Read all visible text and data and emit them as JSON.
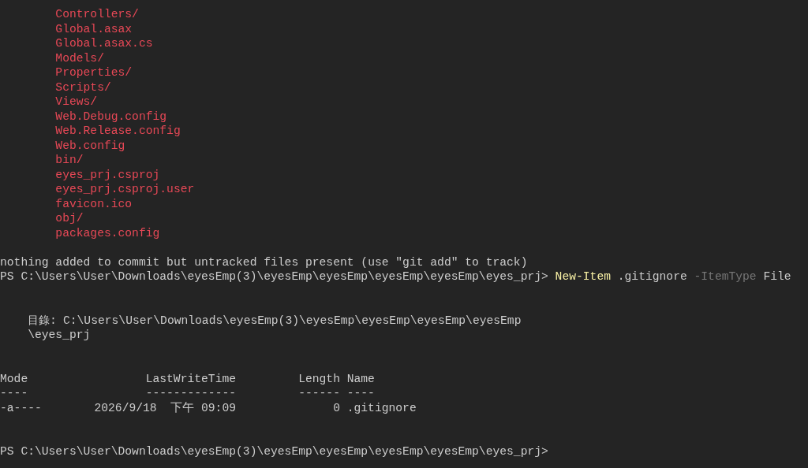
{
  "untracked_files": [
    "Controllers/",
    "Global.asax",
    "Global.asax.cs",
    "Models/",
    "Properties/",
    "Scripts/",
    "Views/",
    "Web.Debug.config",
    "Web.Release.config",
    "Web.config",
    "bin/",
    "eyes_prj.csproj",
    "eyes_prj.csproj.user",
    "favicon.ico",
    "obj/",
    "packages.config"
  ],
  "message": "nothing added to commit but untracked files present (use \"git add\" to track)",
  "command": {
    "prompt": "PS C:\\Users\\User\\Downloads\\eyesEmp(3)\\eyesEmp\\eyesEmp\\eyesEmp\\eyesEmp\\eyes_prj>",
    "tokens": [
      {
        "text": "New-Item",
        "kind": "cmdlet"
      },
      {
        "text": ".gitignore",
        "kind": "argument"
      },
      {
        "text": "-ItemType",
        "kind": "parameter"
      },
      {
        "text": "File",
        "kind": "argument"
      }
    ]
  },
  "directory": {
    "label": "目錄:",
    "path_lines": [
      "C:\\Users\\User\\Downloads\\eyesEmp(3)\\eyesEmp\\eyesEmp\\eyesEmp\\eyesEmp",
      "\\eyes_prj"
    ]
  },
  "table": {
    "columns": [
      "Mode",
      "LastWriteTime",
      "Length",
      "Name"
    ],
    "rules": [
      "----",
      "-------------",
      "------",
      "----"
    ],
    "rows": [
      {
        "mode": "-a----",
        "last_write_time": "2026/9/18  下午 09:09",
        "length": "0",
        "name": ".gitignore"
      }
    ]
  },
  "prompt": "PS C:\\Users\\User\\Downloads\\eyesEmp(3)\\eyesEmp\\eyesEmp\\eyesEmp\\eyesEmp\\eyes_prj>"
}
